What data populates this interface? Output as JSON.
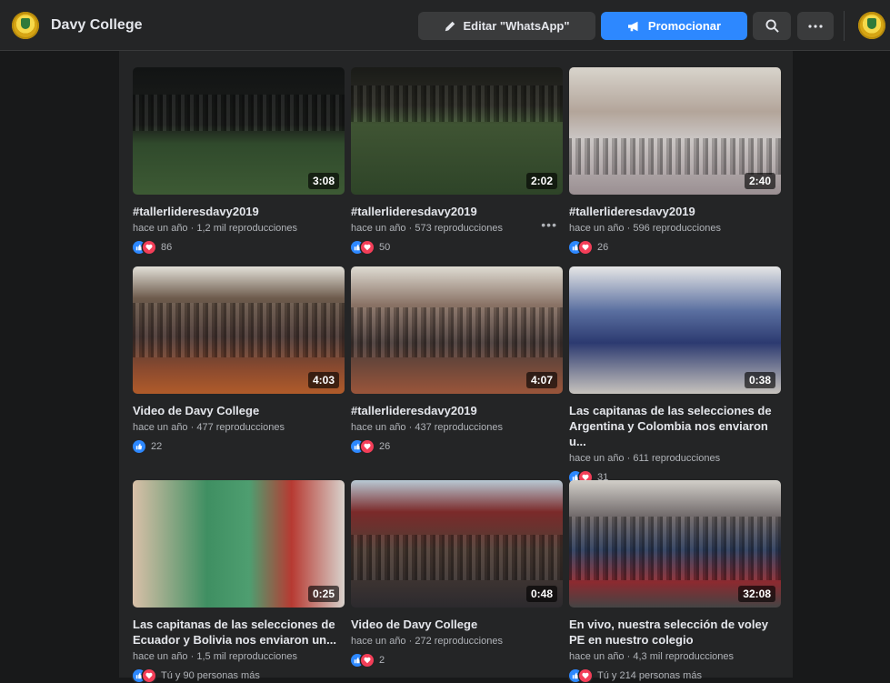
{
  "header": {
    "page_name": "Davy College",
    "edit_button_label": "Editar \"WhatsApp\"",
    "promote_button_label": "Promocionar",
    "colors": {
      "background": "#242526",
      "accent": "#2d88ff"
    }
  },
  "videos": [
    {
      "title": "#tallerlideresdavy2019",
      "duration": "3:08",
      "time": "hace un año",
      "views": "1,2 mil reproducciones",
      "reactions": [
        "like",
        "love"
      ],
      "reaction_count": "86"
    },
    {
      "title": "#tallerlideresdavy2019",
      "duration": "2:02",
      "time": "hace un año",
      "views": "573 reproducciones",
      "reactions": [
        "like",
        "love"
      ],
      "reaction_count": "50"
    },
    {
      "title": "#tallerlideresdavy2019",
      "duration": "2:40",
      "time": "hace un año",
      "views": "596 reproducciones",
      "reactions": [
        "like",
        "love"
      ],
      "reaction_count": "26"
    },
    {
      "title": "Video de Davy College",
      "duration": "4:03",
      "time": "hace un año",
      "views": "477 reproducciones",
      "reactions": [
        "like"
      ],
      "reaction_count": "22"
    },
    {
      "title": "#tallerlideresdavy2019",
      "duration": "4:07",
      "time": "hace un año",
      "views": "437 reproducciones",
      "reactions": [
        "like",
        "love"
      ],
      "reaction_count": "26"
    },
    {
      "title": "Las capitanas de las selecciones de Argentina y Colombia nos enviaron u...",
      "duration": "0:38",
      "time": "hace un año",
      "views": "611 reproducciones",
      "reactions": [
        "like",
        "love"
      ],
      "reaction_count": "31"
    },
    {
      "title": "Las capitanas de las selecciones de Ecuador y Bolivia nos enviaron un...",
      "duration": "0:25",
      "time": "hace un año",
      "views": "1,5 mil reproducciones",
      "reactions": [
        "like",
        "love"
      ],
      "reaction_count": "Tú y 90 personas más"
    },
    {
      "title": "Video de Davy College",
      "duration": "0:48",
      "time": "hace un año",
      "views": "272 reproducciones",
      "reactions": [
        "like",
        "love"
      ],
      "reaction_count": "2"
    },
    {
      "title": "En vivo, nuestra selección de voley PE en nuestro colegio",
      "duration": "32:08",
      "time": "hace un año",
      "views": "4,3 mil reproducciones",
      "reactions": [
        "like",
        "love"
      ],
      "reaction_count": "Tú y 214 personas más"
    }
  ],
  "meta_separator": "·"
}
